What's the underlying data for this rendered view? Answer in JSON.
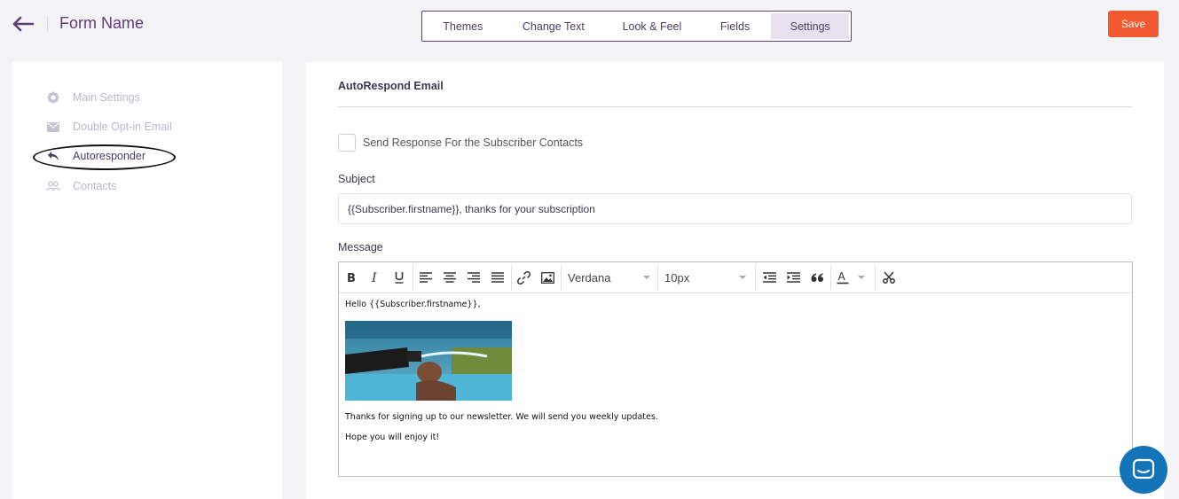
{
  "header": {
    "form_name": "Form Name",
    "save_label": "Save",
    "accent_color": "#5b3e7a",
    "save_color": "#f15a30",
    "tabs": [
      {
        "label": "Themes",
        "active": false
      },
      {
        "label": "Change Text",
        "active": false
      },
      {
        "label": "Look & Feel",
        "active": false
      },
      {
        "label": "Fields",
        "active": false
      },
      {
        "label": "Settings",
        "active": true
      }
    ]
  },
  "sidebar": {
    "items": [
      {
        "label": "Main Settings",
        "icon": "gear-icon",
        "active": false
      },
      {
        "label": "Double Opt-in Email",
        "icon": "envelope-icon",
        "active": false
      },
      {
        "label": "Autoresponder",
        "icon": "reply-icon",
        "active": true
      },
      {
        "label": "Contacts",
        "icon": "contacts-icon",
        "active": false
      }
    ]
  },
  "main": {
    "section_title": "AutoRespond Email",
    "checkbox_label": "Send Response For the Subscriber Contacts",
    "checkbox_checked": false,
    "subject_label": "Subject",
    "subject_value": "{{Subscriber.firstname}}, thanks for your subscription",
    "message_label": "Message",
    "editor": {
      "font_family": "Verdana",
      "font_size": "10px",
      "font_color_label": "A",
      "body_lines": [
        "Hello {{Subscriber.firstname}},",
        "Thanks for signing up to our newsletter. We will send you weekly updates.",
        "Hope you will enjoy it!"
      ]
    }
  }
}
